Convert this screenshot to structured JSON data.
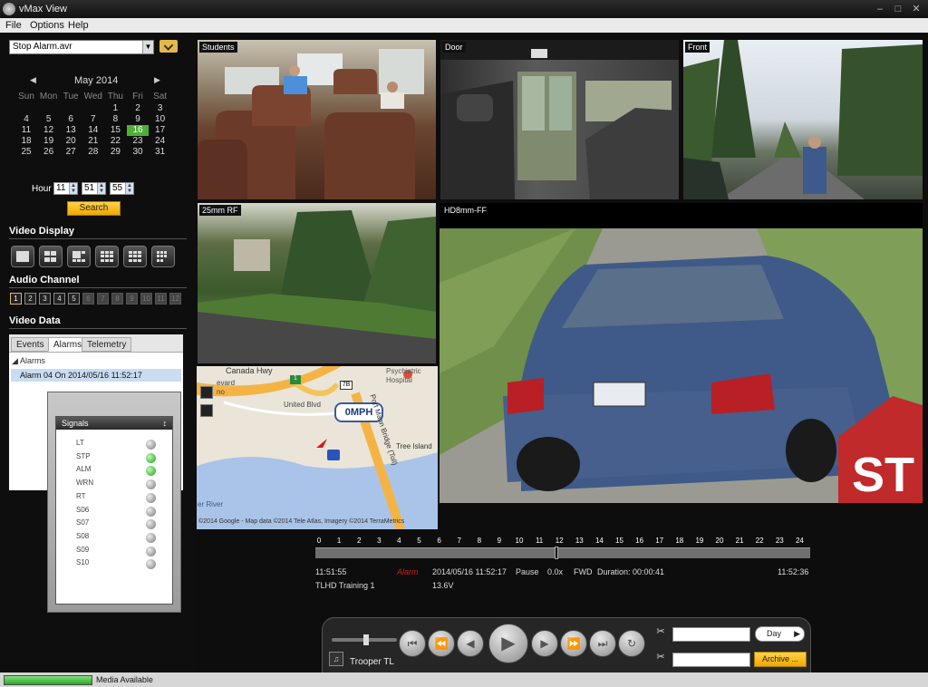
{
  "window": {
    "title": "vMax View"
  },
  "menu": {
    "file": "File",
    "options": "Options",
    "help": "Help"
  },
  "file_select": {
    "value": "Stop Alarm.avr"
  },
  "calendar": {
    "month": "May 2014",
    "weekdays": [
      "Sun",
      "Mon",
      "Tue",
      "Wed",
      "Thu",
      "Fri",
      "Sat"
    ],
    "weeks": [
      [
        "",
        "",
        "",
        "",
        "1",
        "2",
        "3"
      ],
      [
        "4",
        "5",
        "6",
        "7",
        "8",
        "9",
        "10"
      ],
      [
        "11",
        "12",
        "13",
        "14",
        "15",
        "16",
        "17"
      ],
      [
        "18",
        "19",
        "20",
        "21",
        "22",
        "23",
        "24"
      ],
      [
        "25",
        "26",
        "27",
        "28",
        "29",
        "30",
        "31"
      ]
    ],
    "selected_day": "16"
  },
  "time": {
    "label": "Hour",
    "hour": "11",
    "minute": "51",
    "second": "55",
    "search_label": "Search"
  },
  "video_display": {
    "title": "Video Display"
  },
  "audio_channel": {
    "title": "Audio Channel",
    "channels": [
      "1",
      "2",
      "3",
      "4",
      "5",
      "6",
      "7",
      "8",
      "9",
      "10",
      "11",
      "12"
    ]
  },
  "video_data": {
    "title": "Video Data",
    "tabs": [
      "Events",
      "Alarms",
      "Telemetry"
    ],
    "active_tab": "Alarms",
    "group": "Alarms",
    "item": "Alarm 04 On 2014/05/16 11:52:17"
  },
  "signals": {
    "title": "Signals",
    "items": [
      {
        "name": "LT",
        "on": false
      },
      {
        "name": "STP",
        "on": true
      },
      {
        "name": "ALM",
        "on": true
      },
      {
        "name": "WRN",
        "on": false
      },
      {
        "name": "RT",
        "on": false
      },
      {
        "name": "S06",
        "on": false
      },
      {
        "name": "S07",
        "on": false
      },
      {
        "name": "S08",
        "on": false
      },
      {
        "name": "S09",
        "on": false
      },
      {
        "name": "S10",
        "on": false
      }
    ]
  },
  "cameras": {
    "c1": "Students",
    "c2": "Door",
    "c3": "Front",
    "c4": "25mm RF",
    "c5": "HD8mm-FF"
  },
  "map": {
    "speed": "0MPH",
    "road1": "Canada Hwy",
    "road2": "United Blvd",
    "hospital": "Psychiatric Hospital",
    "bridge": "Port Mann Bridge (Toll)",
    "island": "Tree Island",
    "river": "er River",
    "place": "evard",
    "place2": "no",
    "route": "7B",
    "shield": "1",
    "copyright": "©2014 Google - Map data ©2014 Tele Atlas, Imagery ©2014 TerraMetrics"
  },
  "timeline": {
    "ticks": [
      "0",
      "1",
      "2",
      "3",
      "4",
      "5",
      "6",
      "7",
      "8",
      "9",
      "10",
      "11",
      "12",
      "13",
      "14",
      "15",
      "16",
      "17",
      "18",
      "19",
      "20",
      "21",
      "22",
      "23",
      "24"
    ],
    "start_time": "11:51:55",
    "end_time": "11:52:36",
    "alarm_tag": "Alarm",
    "timestamp": "2014/05/16 11:52:17",
    "state": "Pause",
    "speed": "0.0x",
    "direction": "FWD",
    "duration": "Duration: 00:00:41",
    "unit_name": "TLHD Training 1",
    "voltage": "13.6V"
  },
  "controls": {
    "unit": "Trooper TL",
    "range": "Day",
    "archive_label": "Archive ..."
  },
  "status": {
    "text": "Media Available"
  }
}
